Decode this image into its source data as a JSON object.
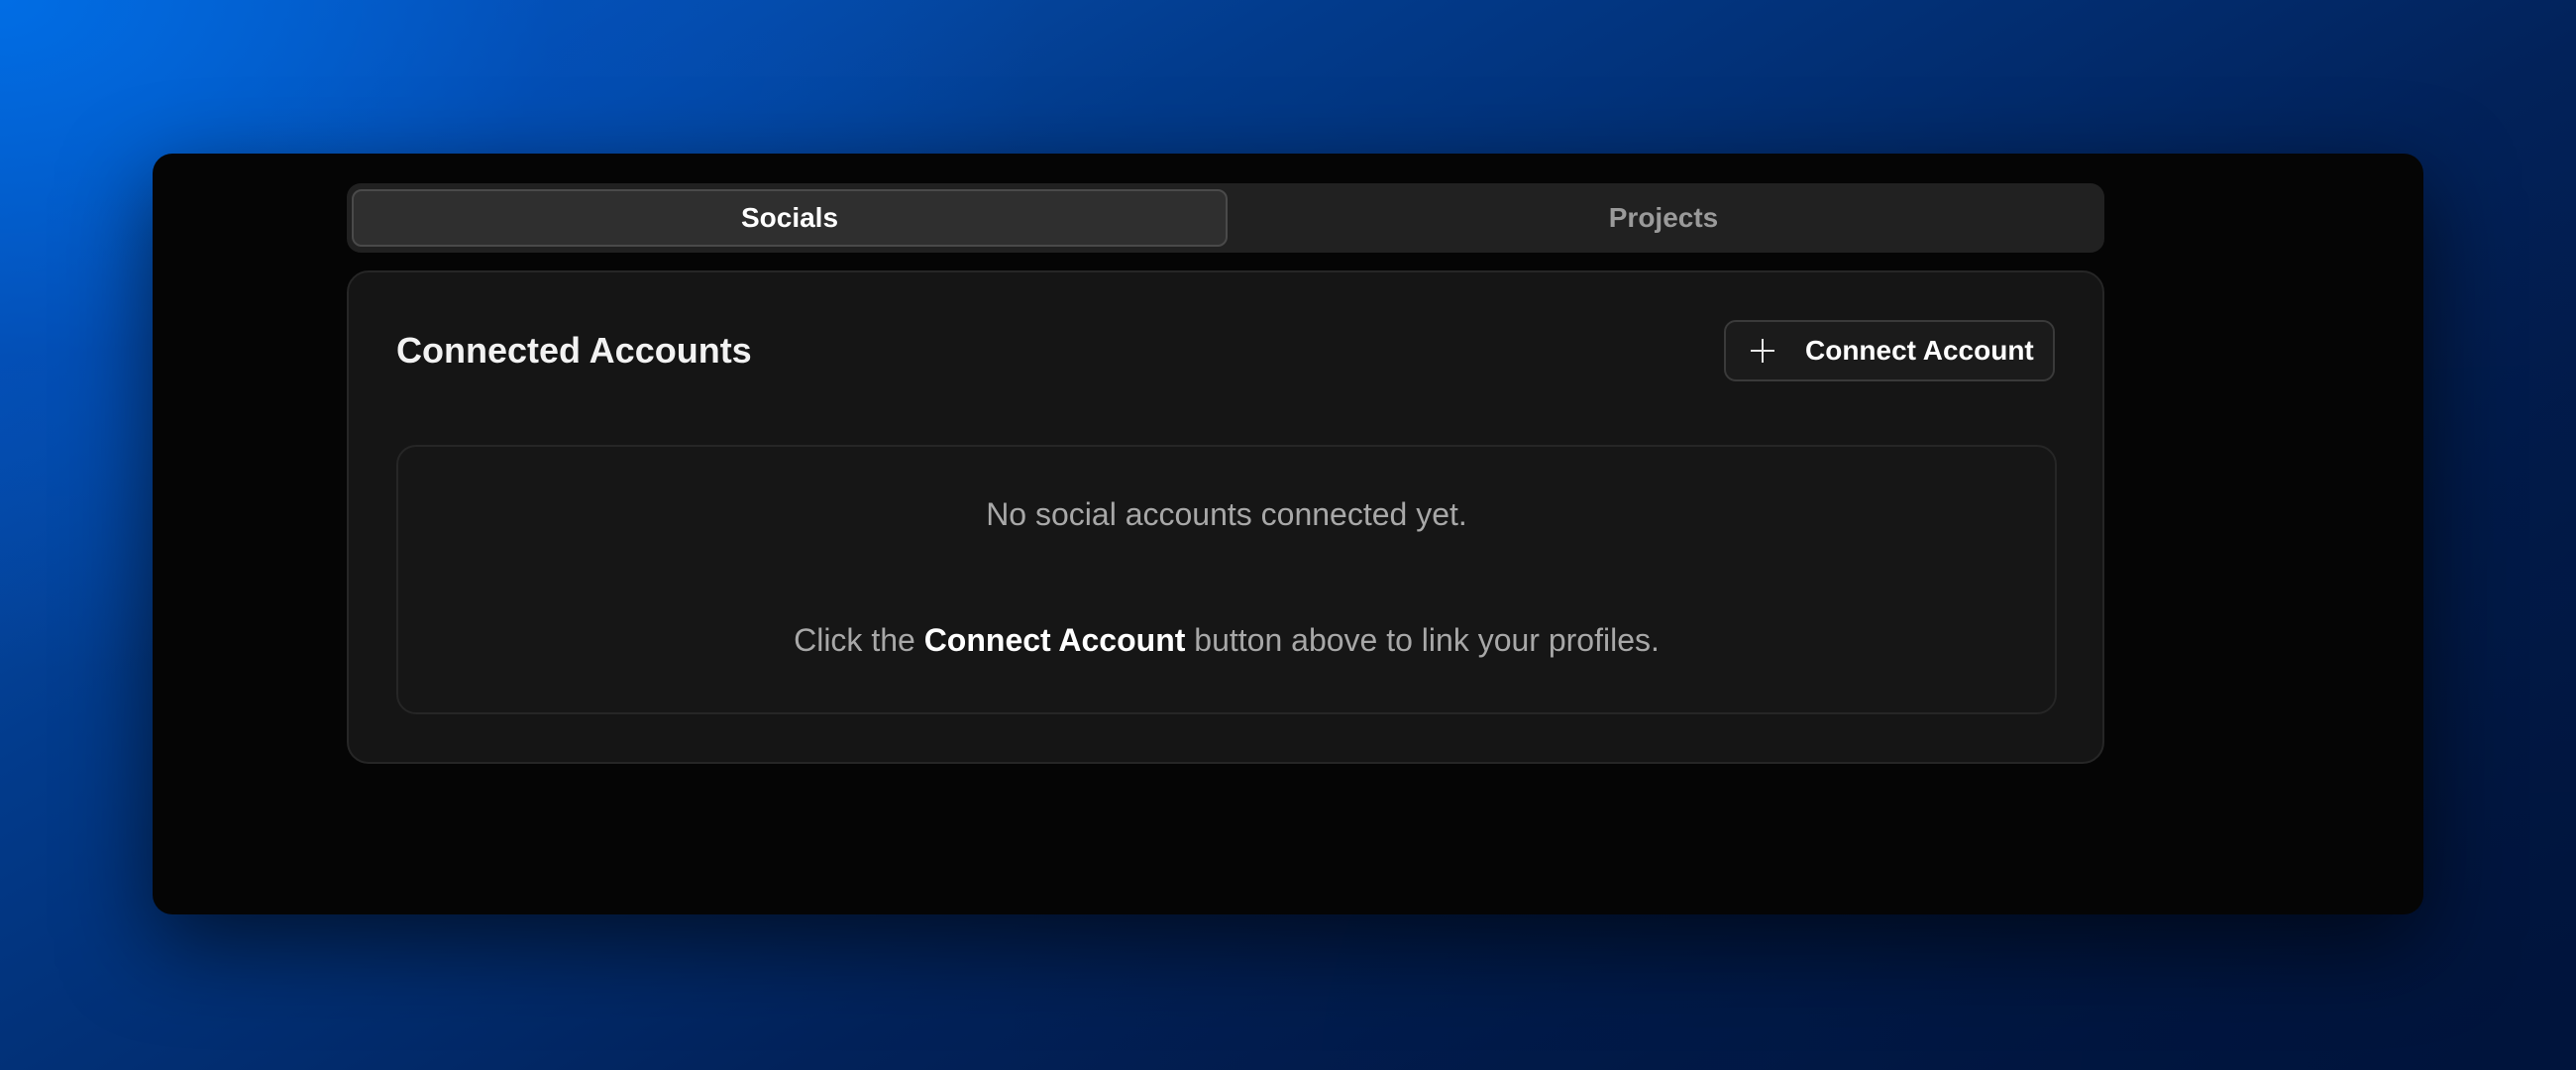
{
  "tabs": [
    {
      "label": "Socials",
      "active": true
    },
    {
      "label": "Projects",
      "active": false
    }
  ],
  "card": {
    "title": "Connected Accounts",
    "connect_button_label": "Connect Account",
    "connect_button_icon": "plus-icon"
  },
  "empty_state": {
    "line1": "No social accounts connected yet.",
    "line2_prefix": "Click the ",
    "line2_bold": "Connect Account",
    "line2_suffix": " button above to link your profiles."
  },
  "colors": {
    "window_bg": "#050505",
    "card_bg": "#151515",
    "accent_text": "#ffffff",
    "muted_text": "#a8a8a8"
  }
}
